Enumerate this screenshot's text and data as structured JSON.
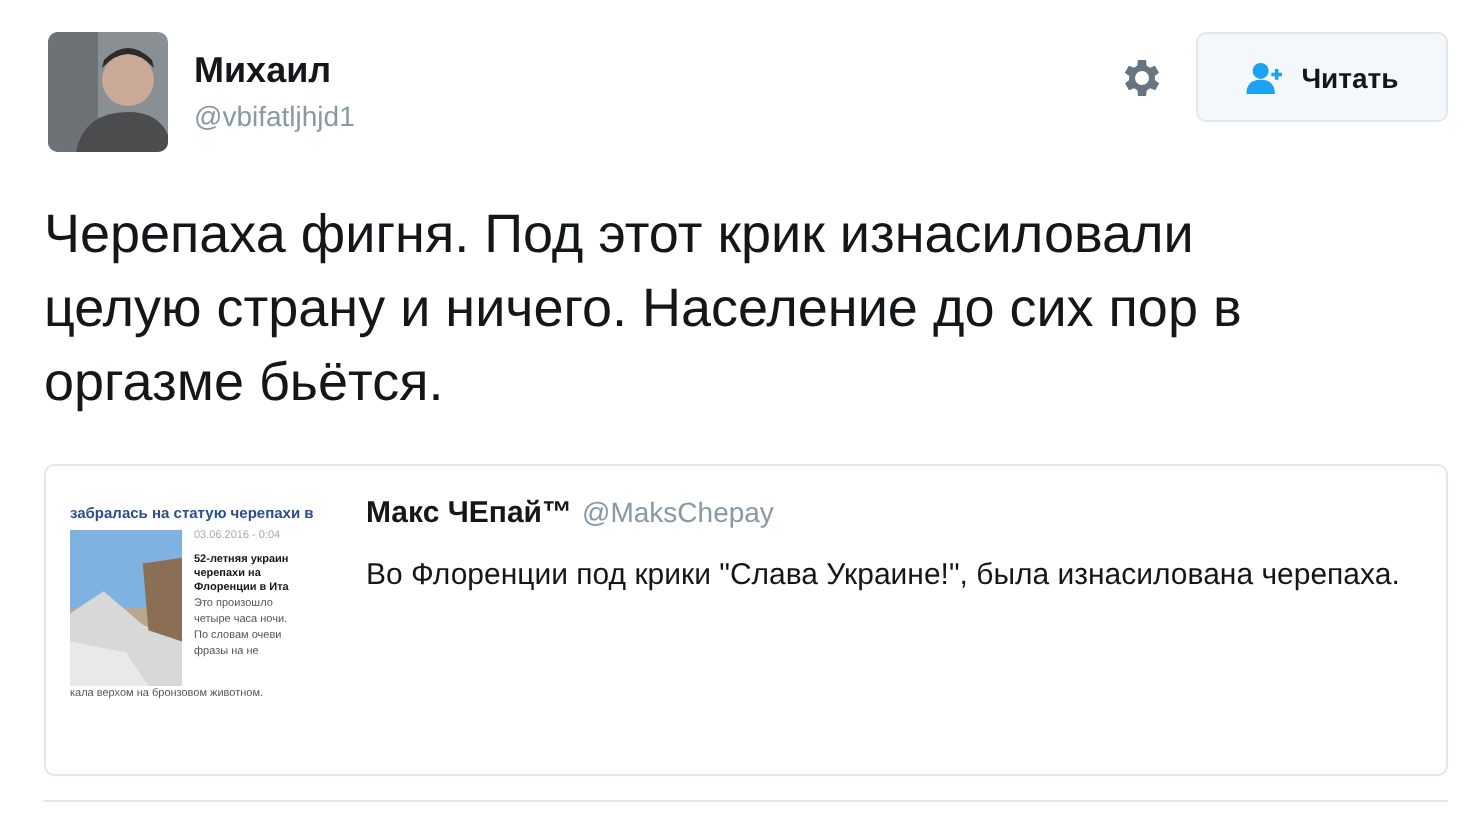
{
  "author": {
    "name": "Михаил",
    "handle": "@vbifatljhjd1"
  },
  "follow_button": {
    "label": "Читать"
  },
  "tweet_text": "Черепаха фигня. Под этот крик изнасиловали целую страну и ничего. Население до сих пор в оргазме бьётся.",
  "quoted_tweet": {
    "name": "Макс ЧЕпай™",
    "handle": "@MaksChepay",
    "text": "Во Флоренции под крики \"Слава Украине!\", была изнасилована черепаха.",
    "thumbnail": {
      "headline": "забралась на статую черепахи в",
      "date": "03.06.2016 - 0:04",
      "lead_lines": [
        "52-летняя украин",
        "черепахи на",
        "Флоренции в Ита"
      ],
      "body_lines": [
        "Это произошло",
        "четыре часа ночи.",
        "По словам очеви",
        "фразы на не"
      ],
      "footer": "кала верхом на бронзовом животном."
    }
  }
}
